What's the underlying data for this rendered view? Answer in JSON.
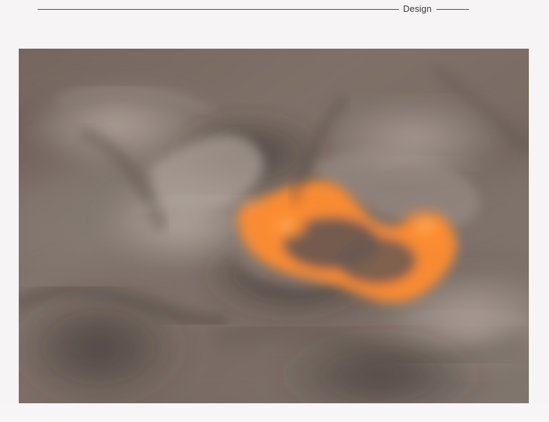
{
  "header": {
    "title": "Design"
  },
  "colors": {
    "background": "#f6f4f5",
    "rule": "#4b4648",
    "fabric_base": "#6f625c",
    "fabric_highlight": "#a89a92",
    "pattern_orange": "#ff8a2a"
  }
}
